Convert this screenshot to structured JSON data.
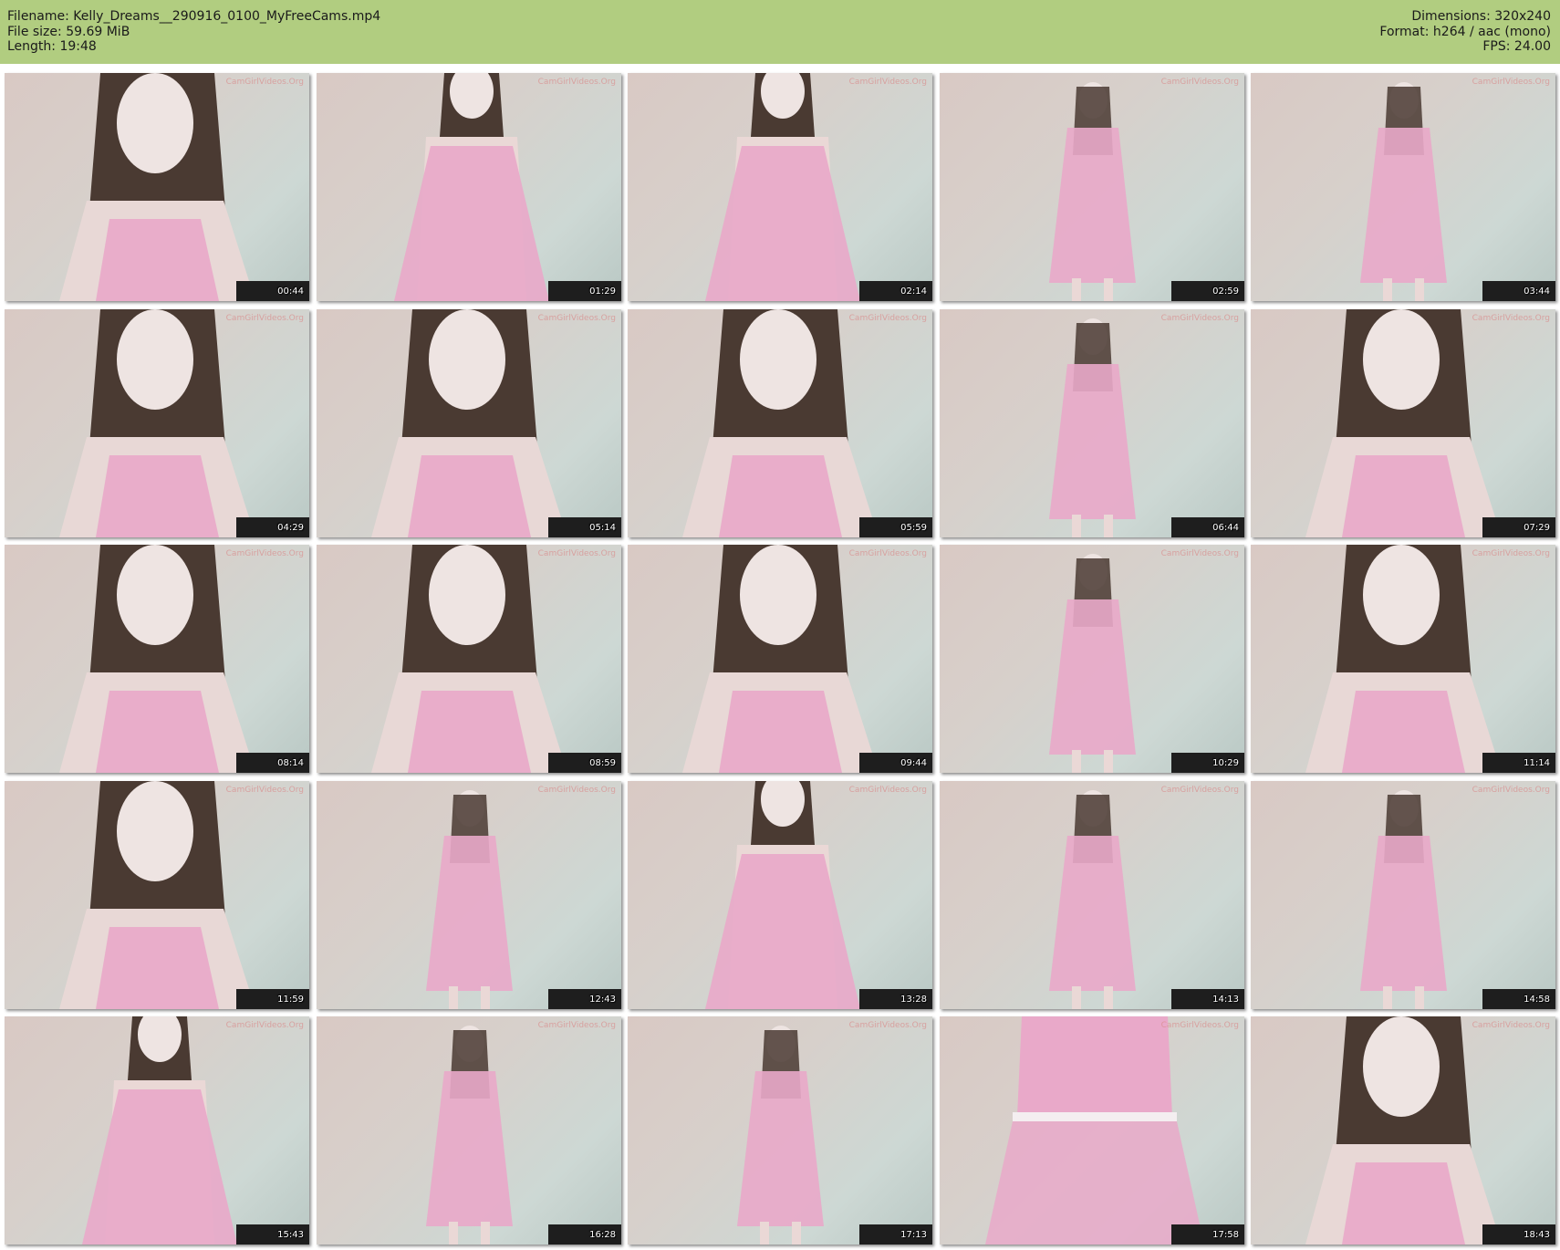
{
  "header": {
    "filename": "Filename: Kelly_Dreams__290916_0100_MyFreeCams.mp4",
    "filesize": "File size: 59.69 MiB",
    "length": "Length: 19:48",
    "dimensions": "Dimensions: 320x240",
    "format": "Format: h264 / aac (mono)",
    "fps": "FPS: 24.00"
  },
  "colors": {
    "header_bg": "#b1cd80",
    "page_bg": "#ffffff",
    "dress": "#e9a9c9"
  },
  "watermark": "CamGirlVideos.Org",
  "thumbnails": [
    {
      "time": "00:44",
      "shot": "close"
    },
    {
      "time": "01:29",
      "shot": "mid"
    },
    {
      "time": "02:14",
      "shot": "mid"
    },
    {
      "time": "02:59",
      "shot": "full"
    },
    {
      "time": "03:44",
      "shot": "full"
    },
    {
      "time": "04:29",
      "shot": "close"
    },
    {
      "time": "05:14",
      "shot": "close"
    },
    {
      "time": "05:59",
      "shot": "close"
    },
    {
      "time": "06:44",
      "shot": "full"
    },
    {
      "time": "07:29",
      "shot": "close"
    },
    {
      "time": "08:14",
      "shot": "close"
    },
    {
      "time": "08:59",
      "shot": "close"
    },
    {
      "time": "09:44",
      "shot": "close"
    },
    {
      "time": "10:29",
      "shot": "full"
    },
    {
      "time": "11:14",
      "shot": "close"
    },
    {
      "time": "11:59",
      "shot": "close"
    },
    {
      "time": "12:43",
      "shot": "full"
    },
    {
      "time": "13:28",
      "shot": "mid"
    },
    {
      "time": "14:13",
      "shot": "full"
    },
    {
      "time": "14:58",
      "shot": "full"
    },
    {
      "time": "15:43",
      "shot": "mid"
    },
    {
      "time": "16:28",
      "shot": "full"
    },
    {
      "time": "17:13",
      "shot": "full"
    },
    {
      "time": "17:58",
      "shot": "dress"
    },
    {
      "time": "18:43",
      "shot": "close"
    }
  ]
}
